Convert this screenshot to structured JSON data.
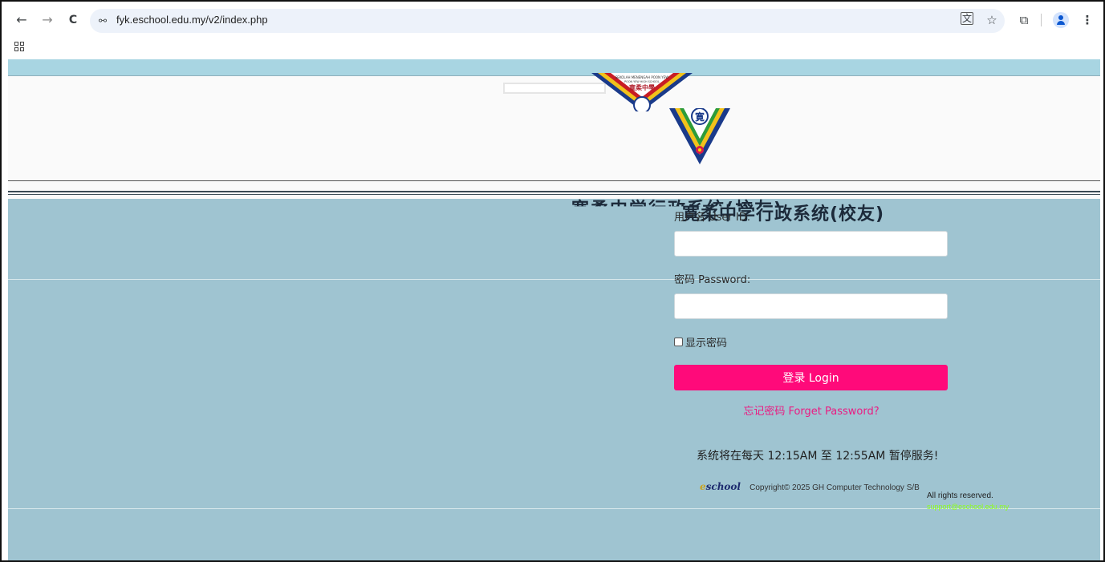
{
  "browser": {
    "url": "fyk.eschool.edu.my/v2/index.php",
    "icons": [
      "back-icon",
      "forward-icon",
      "reload-icon",
      "site-info-icon",
      "translate-icon",
      "star-icon",
      "extensions-icon",
      "profile-icon",
      "menu-icon",
      "apps-icon"
    ],
    "glyphs": {
      "back": "←",
      "forward": "→",
      "reload": "C",
      "site": "⚯",
      "translate": "文",
      "star": "☆",
      "extensions": "⧉",
      "menu": "⋮"
    }
  },
  "header": {
    "crest_text_top": "SEKOLAH MENENGAH POON YEW",
    "crest_text_mid": "POON YEW HIGH SCHOOL",
    "crest_chinese": "寛柔中學",
    "title": "寛柔中学行政系统(校友)"
  },
  "login": {
    "user_label": "用户名 User ID:",
    "user_value": "",
    "password_label": "密码 Password:",
    "password_value": "",
    "show_password_label": "显示密码",
    "login_button": "登录 Login",
    "forgot_link": "忘记密码 Forget Password?"
  },
  "notice": "系统将在每天 12:15AM 至 12:55AM 暂停服务!",
  "footer": {
    "logo_prefix": "e",
    "logo_word": "school",
    "copyright": "Copyright© 2025 GH Computer Technology S/B",
    "rights": "All rights reserved.",
    "support": "support@eschool.edu.my"
  },
  "colors": {
    "accent": "#ff0a7a",
    "page_bg": "#9fc4d1",
    "strip": "#a8d5e2",
    "link": "#ea1b82",
    "support_text": "#8cff1a"
  }
}
